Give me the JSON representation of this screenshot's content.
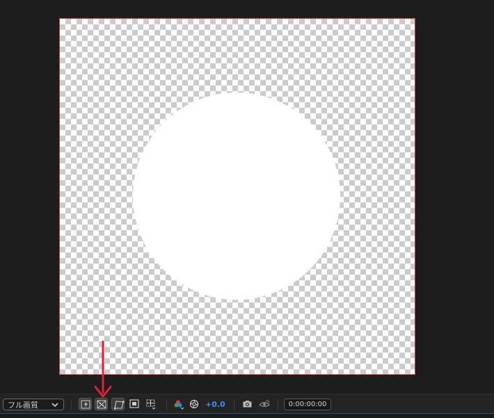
{
  "viewer": {
    "background": "#1d1d1d",
    "comp_border_color": "#cf3b3b",
    "shape_color": "#ffffff"
  },
  "toolbar": {
    "quality_label": "フル画質",
    "exposure_value": "+0.0",
    "timecode": "0:00:00:00",
    "icons": [
      "fast-preview-icon",
      "transparency-grid-icon",
      "mask-path-icon",
      "region-of-interest-icon",
      "safe-margins-icon",
      "color-channels-icon",
      "reset-exposure-icon",
      "snapshot-camera-icon",
      "show-snapshot-icon"
    ],
    "accent_color": "#3f8cff"
  },
  "annotation": {
    "arrow_color": "#e0213a"
  }
}
